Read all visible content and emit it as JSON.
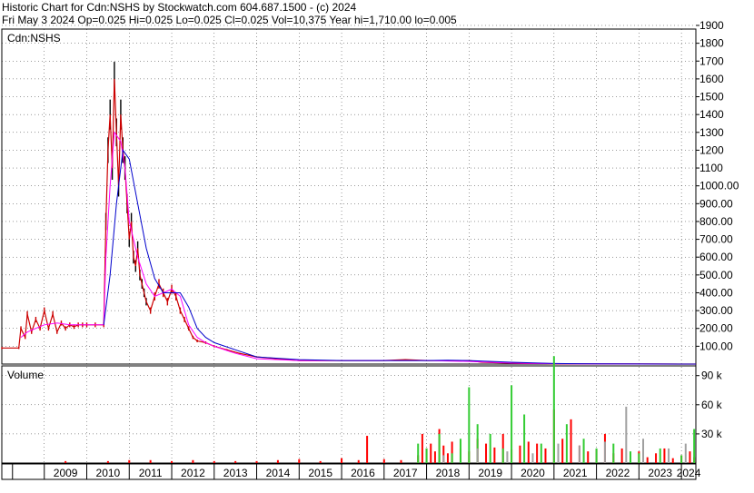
{
  "header": {
    "title": "Historic Chart for Cdn:NSHS by Stockwatch.com 604.687.1500 - (c) 2024",
    "quote": "Fri May  3 2024  Op=0.025  Hi=0.025  Lo=0.025  Cl=0.025  Vol=10,375  Year hi=1,710.00  lo=0.005"
  },
  "colors": {
    "price": "#cc0000",
    "ohlc_black": "#000000",
    "ma_short": "#ff00ff",
    "ma_long": "#0000cc",
    "vol_red": "#ff0000",
    "vol_green": "#33cc33",
    "vol_gray": "#a0a0a0"
  },
  "chart_data": [
    {
      "type": "line",
      "title": "Cdn:NSHS",
      "xlabel": "",
      "ylabel": "",
      "ylim": [
        0,
        1900
      ],
      "grid": true,
      "ytick_labels": [
        "1900",
        "1800",
        "1700",
        "1600",
        "1500",
        "1400",
        "1300",
        "1200",
        "1100",
        "1000.00",
        "900.00",
        "800.00",
        "700.00",
        "600.00",
        "500.00",
        "400.00",
        "300.00",
        "200.00",
        "100.00"
      ],
      "x_labels": [
        "2009",
        "2010",
        "2011",
        "2012",
        "2013",
        "2014",
        "2015",
        "2016",
        "2017",
        "2018",
        "2019",
        "2020",
        "2021",
        "2022",
        "2023",
        "2024"
      ],
      "series": [
        {
          "x": [
            2008.0,
            2008.4,
            2008.45,
            2008.55,
            2008.6,
            2008.7,
            2008.8,
            2008.9,
            2009.0,
            2009.1,
            2009.2,
            2009.3,
            2009.4,
            2009.5,
            2009.6,
            2009.7,
            2009.8,
            2009.9,
            2010.0,
            2010.2,
            2010.4,
            2010.45,
            2010.5,
            2010.55,
            2010.6,
            2010.65,
            2010.7,
            2010.75,
            2010.8,
            2010.85,
            2010.9,
            2010.95,
            2011.0,
            2011.05,
            2011.1,
            2011.15,
            2011.2,
            2011.25,
            2011.3,
            2011.35,
            2011.4,
            2011.5,
            2011.6,
            2011.7,
            2011.8,
            2011.9,
            2012.0,
            2012.1,
            2012.2,
            2012.3,
            2012.4,
            2012.5,
            2012.6,
            2012.8,
            2013.0,
            2013.3,
            2013.6,
            2014.0,
            2015.0,
            2016.0,
            2017.0,
            2017.5,
            2018.0,
            2018.5,
            2019.0,
            2019.3,
            2020.0,
            2021.0,
            2022.0,
            2023.0,
            2024.0,
            2024.34
          ],
          "values": [
            90,
            90,
            200,
            150,
            280,
            180,
            250,
            200,
            300,
            200,
            280,
            180,
            230,
            200,
            220,
            210,
            220,
            220,
            220,
            220,
            220,
            800,
            1200,
            1400,
            1100,
            1600,
            1300,
            1000,
            1400,
            1200,
            1100,
            900,
            700,
            800,
            600,
            550,
            650,
            500,
            450,
            400,
            350,
            300,
            380,
            450,
            400,
            350,
            420,
            380,
            300,
            250,
            200,
            150,
            130,
            120,
            100,
            80,
            60,
            40,
            20,
            20,
            20,
            25,
            20,
            20,
            20,
            10,
            5,
            2,
            1,
            0.5,
            0.05,
            0.025
          ]
        },
        {
          "x": [
            2008.45,
            2008.6,
            2008.8,
            2009.0,
            2009.3,
            2009.6,
            2010.0,
            2010.2,
            2010.4,
            2010.45,
            2010.55,
            2010.65,
            2010.8,
            2010.9,
            2011.0,
            2011.2,
            2011.4,
            2011.6,
            2011.8,
            2012.0,
            2012.2,
            2012.4,
            2012.6,
            2012.8,
            2013.0,
            2013.5,
            2014.0,
            2015.0,
            2016.0,
            2017.0,
            2018.0,
            2019.0,
            2020.0,
            2021.0,
            2022.0,
            2023.0,
            2024.0,
            2024.34
          ],
          "values": [
            150,
            180,
            200,
            220,
            230,
            220,
            220,
            220,
            220,
            600,
            1000,
            1300,
            1250,
            1100,
            800,
            600,
            450,
            380,
            400,
            420,
            380,
            220,
            150,
            120,
            100,
            60,
            30,
            20,
            20,
            20,
            20,
            15,
            5,
            2,
            1,
            0.5,
            0.1,
            0.03
          ]
        },
        {
          "x": [
            2010.4,
            2010.55,
            2010.7,
            2010.85,
            2011.0,
            2011.2,
            2011.4,
            2011.6,
            2011.8,
            2012.0,
            2012.2,
            2012.4,
            2012.6,
            2012.8,
            2013.0,
            2013.5,
            2014.0,
            2015.0,
            2016.0,
            2017.0,
            2018.0,
            2018.5,
            2019.0,
            2020.0,
            2021.0,
            2022.0,
            2023.0,
            2024.0,
            2024.34
          ],
          "values": [
            220,
            500,
            900,
            1200,
            1150,
            900,
            650,
            480,
            400,
            400,
            400,
            320,
            200,
            150,
            120,
            80,
            40,
            25,
            20,
            20,
            20,
            22,
            20,
            10,
            3,
            1,
            0.5,
            0.1,
            0.05
          ]
        }
      ]
    },
    {
      "type": "bar",
      "title": "Volume",
      "xlabel": "",
      "ylabel": "",
      "ylim": [
        0,
        100000
      ],
      "ytick_labels": [
        "90 k",
        "60 k",
        "30 k"
      ],
      "series": [
        {
          "x": [
            2009.5,
            2010.5,
            2011.0,
            2011.5,
            2012.0,
            2012.5,
            2013.0,
            2013.5,
            2014.0,
            2014.5,
            2015.0,
            2015.5,
            2016.0,
            2016.4,
            2016.6,
            2017.0,
            2017.4,
            2017.8,
            2017.9,
            2018.0,
            2018.1,
            2018.2,
            2018.3,
            2018.4,
            2018.5,
            2018.6,
            2018.8,
            2019.0,
            2019.2,
            2019.4,
            2019.6,
            2019.8,
            2020.0,
            2020.2,
            2020.4,
            2020.6,
            2020.8,
            2021.0,
            2021.2,
            2021.4,
            2021.6,
            2021.8,
            2022.0,
            2022.2,
            2022.4,
            2022.6,
            2022.8,
            2023.0,
            2023.2,
            2023.4,
            2023.6,
            2023.8,
            2024.0,
            2024.2,
            2024.3
          ],
          "values": [
            2000,
            2000,
            3000,
            3000,
            2000,
            3000,
            2000,
            2000,
            2000,
            3000,
            4000,
            2000,
            5000,
            3000,
            28000,
            4000,
            3000,
            8000,
            30000,
            15000,
            20000,
            12000,
            35000,
            18000,
            10000,
            22000,
            15000,
            12000,
            25000,
            20000,
            16000,
            30000,
            14000,
            18000,
            22000,
            20000,
            15000,
            55000,
            25000,
            45000,
            18000,
            12000,
            14000,
            30000,
            10000,
            15000,
            8000,
            12000,
            6000,
            10000,
            15000,
            5000,
            8000,
            12000,
            6000
          ]
        },
        {
          "x": [
            2017.8,
            2018.0,
            2018.3,
            2018.6,
            2018.8,
            2019.0,
            2019.2,
            2019.5,
            2019.8,
            2020.0,
            2020.3,
            2020.7,
            2021.0,
            2021.3,
            2021.7,
            2022.0,
            2022.4,
            2022.8,
            2023.0,
            2023.5,
            2024.0,
            2024.3
          ],
          "values": [
            20000,
            15000,
            30000,
            10000,
            25000,
            78000,
            40000,
            30000,
            15000,
            80000,
            50000,
            20000,
            110000,
            40000,
            25000,
            15000,
            20000,
            12000,
            10000,
            15000,
            8000,
            35000
          ]
        },
        {
          "x": [
            2018.4,
            2019.2,
            2019.9,
            2020.5,
            2021.1,
            2021.6,
            2022.2,
            2022.7,
            2023.1,
            2023.7,
            2024.1
          ],
          "values": [
            8000,
            15000,
            12000,
            10000,
            20000,
            18000,
            22000,
            58000,
            25000,
            15000,
            20000
          ]
        }
      ]
    }
  ]
}
